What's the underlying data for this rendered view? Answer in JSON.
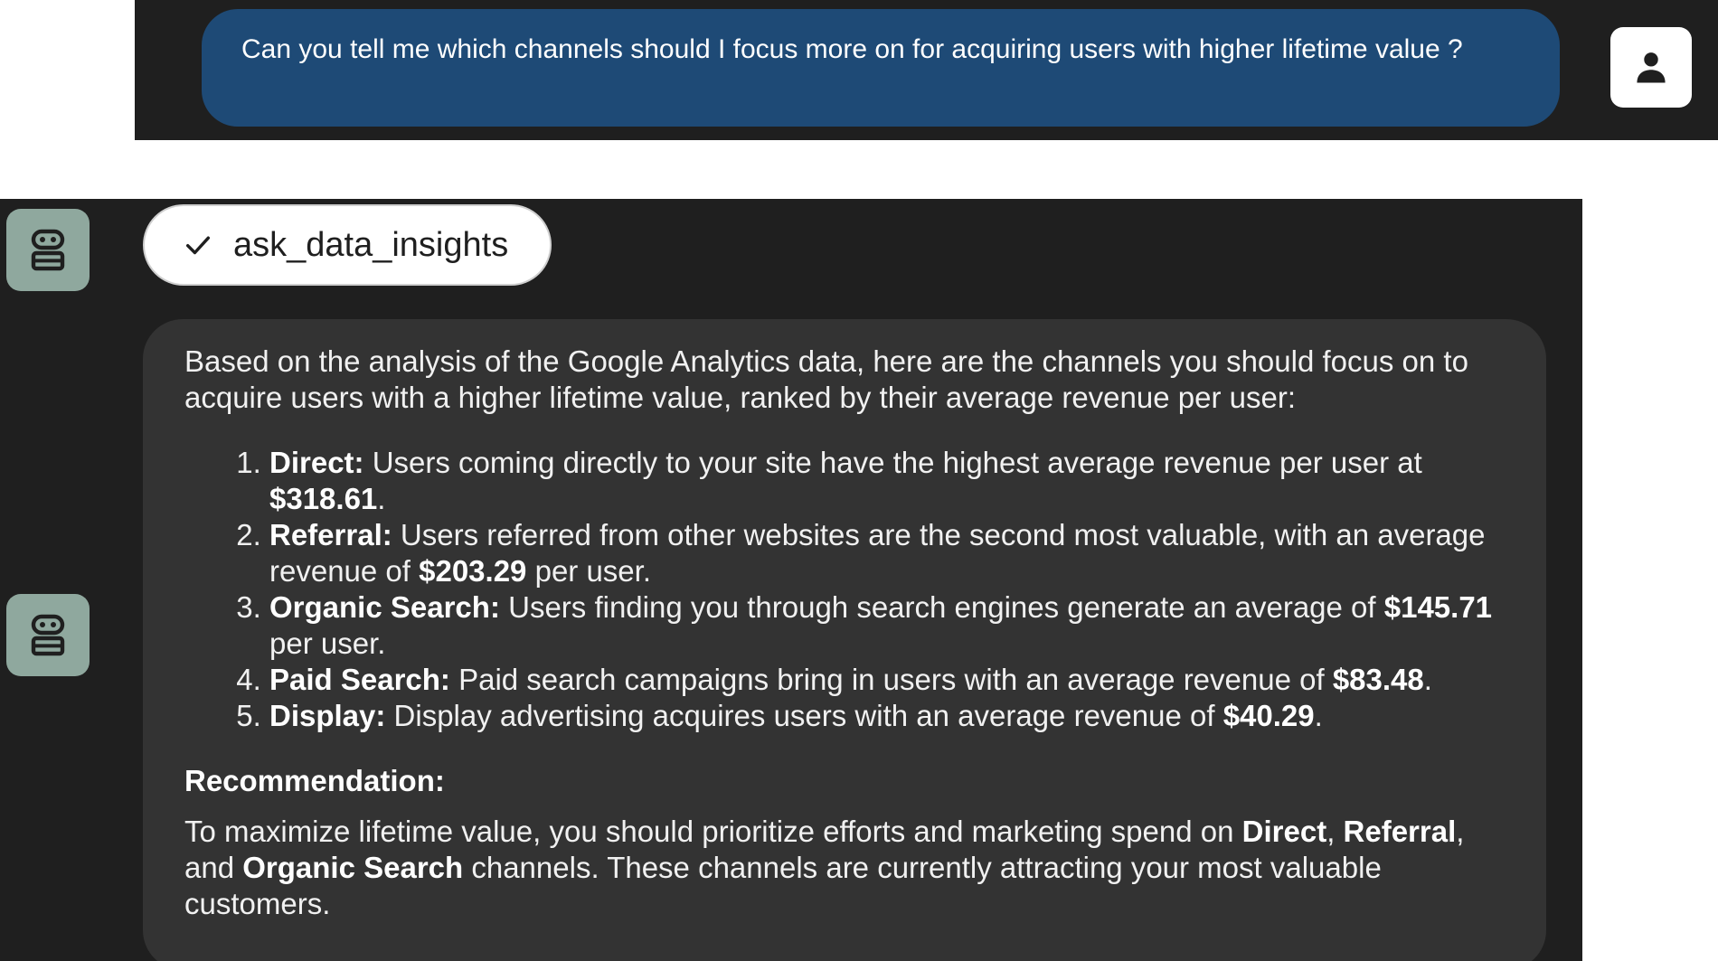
{
  "user_message": {
    "text": "Can you tell me which channels should I focus more on for acquiring users with higher lifetime value ?"
  },
  "tool_call": {
    "name": "ask_data_insights",
    "status_icon": "check-icon"
  },
  "icons": {
    "user_avatar": "person-icon",
    "agent_avatar": "robot-icon"
  },
  "colors": {
    "user_bubble": "#1e4a76",
    "agent_avatar_bg": "#8fa89e",
    "panel_bg": "#1f1f1f",
    "card_bg": "#333333"
  },
  "response": {
    "intro": "Based on the analysis of the Google Analytics data, here are the channels you should focus on to acquire users with a higher lifetime value, ranked by their average revenue per user:",
    "channels": [
      {
        "name": "Direct:",
        "pre": " Users coming directly to your site have the highest average revenue per user at ",
        "value": "$318.61",
        "post": "."
      },
      {
        "name": "Referral:",
        "pre": " Users referred from other websites are the second most valuable, with an average revenue of ",
        "value": "$203.29",
        "post": " per user."
      },
      {
        "name": "Organic Search:",
        "pre": " Users finding you through search engines generate an average of ",
        "value": "$145.71",
        "post": " per user."
      },
      {
        "name": "Paid Search:",
        "pre": " Paid search campaigns bring in users with an average revenue of ",
        "value": "$83.48",
        "post": "."
      },
      {
        "name": "Display:",
        "pre": " Display advertising acquires users with an average revenue of ",
        "value": "$40.29",
        "post": "."
      }
    ],
    "recommendation_heading": "Recommendation:",
    "recommendation": {
      "t1": "To maximize lifetime value, you should prioritize efforts and marketing spend on ",
      "b1": "Direct",
      "t2": ", ",
      "b2": "Referral",
      "t3": ", and ",
      "b3": "Organic Search",
      "t4": " channels. These channels are currently attracting your most valuable customers."
    }
  }
}
